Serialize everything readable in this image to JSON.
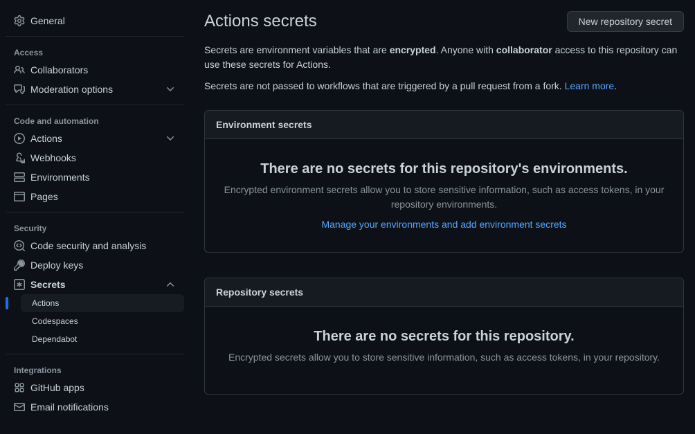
{
  "sidebar": {
    "general": "General",
    "groups": {
      "access": {
        "title": "Access",
        "collaborators": "Collaborators",
        "moderation": "Moderation options"
      },
      "code": {
        "title": "Code and automation",
        "actions": "Actions",
        "webhooks": "Webhooks",
        "environments": "Environments",
        "pages": "Pages"
      },
      "security": {
        "title": "Security",
        "codesec": "Code security and analysis",
        "deploykeys": "Deploy keys",
        "secrets": "Secrets",
        "sub": {
          "actions": "Actions",
          "codespaces": "Codespaces",
          "dependabot": "Dependabot"
        }
      },
      "integrations": {
        "title": "Integrations",
        "ghapps": "GitHub apps",
        "email": "Email notifications"
      }
    }
  },
  "header": {
    "title": "Actions secrets",
    "new_button": "New repository secret"
  },
  "intro": {
    "p1a": "Secrets are environment variables that are ",
    "p1b": "encrypted",
    "p1c": ". Anyone with ",
    "p1d": "collaborator",
    "p1e": " access to this repository can use these secrets for Actions.",
    "p2a": "Secrets are not passed to workflows that are triggered by a pull request from a fork. ",
    "p2link": "Learn more",
    "p2b": "."
  },
  "env_panel": {
    "header": "Environment secrets",
    "empty_title": "There are no secrets for this repository's environments.",
    "empty_desc": "Encrypted environment secrets allow you to store sensitive information, such as access tokens, in your repository environments.",
    "manage_link": "Manage your environments and add environment secrets"
  },
  "repo_panel": {
    "header": "Repository secrets",
    "empty_title": "There are no secrets for this repository.",
    "empty_desc": "Encrypted secrets allow you to store sensitive information, such as access tokens, in your repository."
  }
}
